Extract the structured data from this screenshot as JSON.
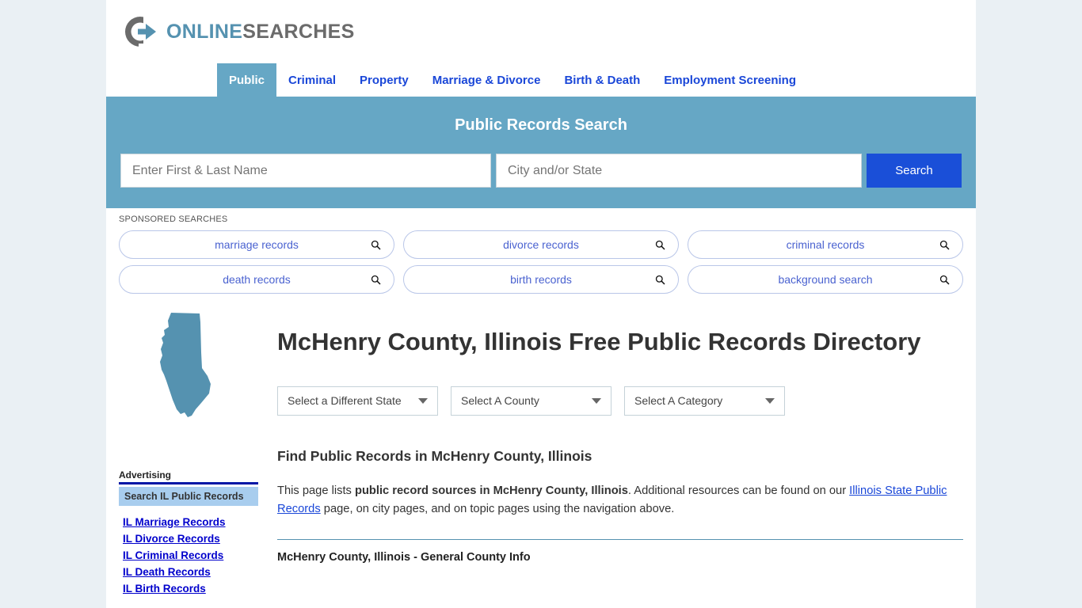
{
  "brand": {
    "name_part1": "ONLINE",
    "name_part2": "SEARCHES",
    "logo_icon": "circular-arrow-icon",
    "accent_teal": "#66a7c5",
    "accent_gray": "#6b6b6b"
  },
  "nav": {
    "tabs": [
      {
        "label": "Public",
        "active": true
      },
      {
        "label": "Criminal",
        "active": false
      },
      {
        "label": "Property",
        "active": false
      },
      {
        "label": "Marriage & Divorce",
        "active": false
      },
      {
        "label": "Birth & Death",
        "active": false
      },
      {
        "label": "Employment Screening",
        "active": false
      }
    ]
  },
  "banner": {
    "title": "Public Records Search",
    "background_color": "#66a7c5",
    "name_placeholder": "Enter First & Last Name",
    "name_value": "",
    "city_placeholder": "City and/or State",
    "city_value": "",
    "search_label": "Search",
    "search_button_color": "#1a4fd8"
  },
  "sponsored": {
    "label": "SPONSORED SEARCHES",
    "items": [
      {
        "label": "marriage records",
        "icon": "magnifier-icon"
      },
      {
        "label": "divorce records",
        "icon": "magnifier-icon"
      },
      {
        "label": "criminal records",
        "icon": "magnifier-icon"
      },
      {
        "label": "death records",
        "icon": "magnifier-icon"
      },
      {
        "label": "birth records",
        "icon": "magnifier-icon"
      },
      {
        "label": "background search",
        "icon": "magnifier-icon"
      }
    ]
  },
  "main": {
    "state_map_icon": "illinois-state-map-icon",
    "state_map_color": "#5592b0",
    "title": "McHenry County, Illinois Free Public Records Directory",
    "selects": [
      {
        "value": "Select a Different State",
        "icon": "chevron-down-icon"
      },
      {
        "value": "Select A County",
        "icon": "chevron-down-icon"
      },
      {
        "value": "Select A Category",
        "icon": "chevron-down-icon"
      }
    ],
    "section_heading": "Find Public Records in McHenry County, Illinois",
    "paragraph": {
      "part1": "This page lists ",
      "bold1": "public record sources in McHenry County, Illinois",
      "part2": ". Additional resources can be found on our ",
      "link": "Illinois State Public Records",
      "part3": " page, on city pages, and on topic pages using the navigation above."
    },
    "sub_heading": "McHenry County, Illinois - General County Info"
  },
  "sidebar": {
    "advertising_label": "Advertising",
    "box_label": "Search IL Public Records",
    "box_color": "#a8cdee",
    "links": [
      {
        "label": "IL Marriage Records"
      },
      {
        "label": "IL Divorce Records"
      },
      {
        "label": "IL Criminal Records"
      },
      {
        "label": "IL Death Records"
      },
      {
        "label": "IL Birth Records"
      }
    ]
  }
}
